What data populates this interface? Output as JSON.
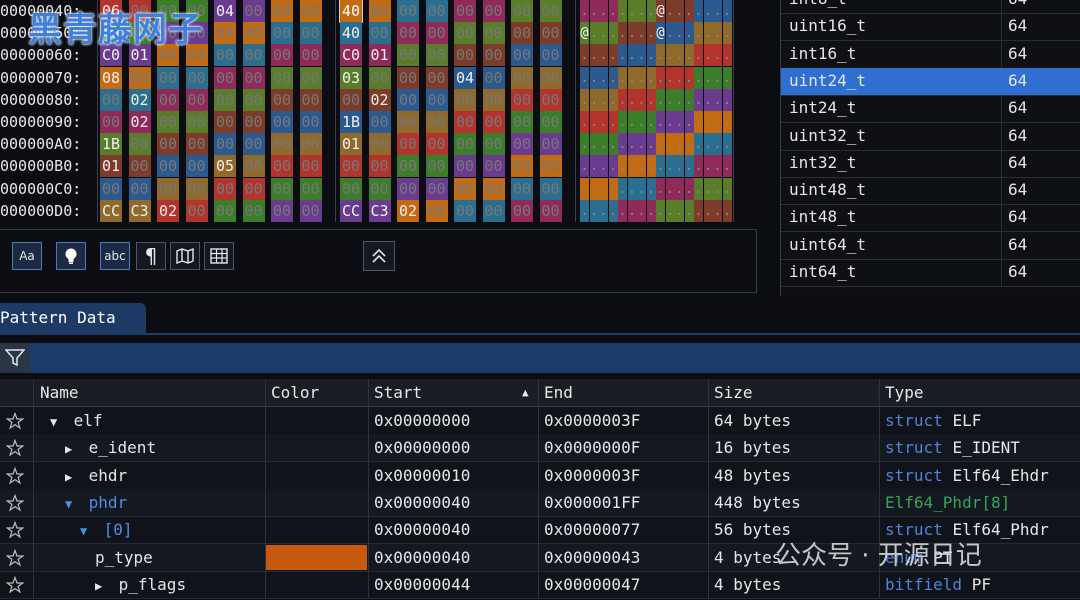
{
  "hex_view": {
    "rows": [
      {
        "addr": "00000040:",
        "bytes1": [
          "06",
          "00",
          "00",
          "00",
          "04",
          "00",
          "00",
          "00"
        ],
        "bytes2": [
          "40",
          "00",
          "00",
          "00",
          "00",
          "00",
          "00",
          "00"
        ],
        "ascii": "........@......."
      },
      {
        "addr": "00000050:",
        "bytes1": [
          "40",
          "00",
          "00",
          "00",
          "00",
          "00",
          "00",
          "00"
        ],
        "bytes2": [
          "40",
          "00",
          "00",
          "00",
          "00",
          "00",
          "00",
          "00"
        ],
        "ascii": "@.......@......."
      },
      {
        "addr": "00000060:",
        "bytes1": [
          "C0",
          "01",
          "00",
          "00",
          "00",
          "00",
          "00",
          "00"
        ],
        "bytes2": [
          "C0",
          "01",
          "00",
          "00",
          "00",
          "00",
          "00",
          "00"
        ],
        "ascii": "................"
      },
      {
        "addr": "00000070:",
        "bytes1": [
          "08",
          "00",
          "00",
          "00",
          "00",
          "00",
          "00",
          "00"
        ],
        "bytes2": [
          "03",
          "00",
          "00",
          "00",
          "04",
          "00",
          "00",
          "00"
        ],
        "ascii": "................"
      },
      {
        "addr": "00000080:",
        "bytes1": [
          "00",
          "02",
          "00",
          "00",
          "00",
          "00",
          "00",
          "00"
        ],
        "bytes2": [
          "00",
          "02",
          "00",
          "00",
          "00",
          "00",
          "00",
          "00"
        ],
        "ascii": "................"
      },
      {
        "addr": "00000090:",
        "bytes1": [
          "00",
          "02",
          "00",
          "00",
          "00",
          "00",
          "00",
          "00"
        ],
        "bytes2": [
          "1B",
          "00",
          "00",
          "00",
          "00",
          "00",
          "00",
          "00"
        ],
        "ascii": "................"
      },
      {
        "addr": "000000A0:",
        "bytes1": [
          "1B",
          "00",
          "00",
          "00",
          "00",
          "00",
          "00",
          "00"
        ],
        "bytes2": [
          "01",
          "00",
          "00",
          "00",
          "00",
          "00",
          "00",
          "00"
        ],
        "ascii": "................"
      },
      {
        "addr": "000000B0:",
        "bytes1": [
          "01",
          "00",
          "00",
          "00",
          "05",
          "00",
          "00",
          "00"
        ],
        "bytes2": [
          "00",
          "00",
          "00",
          "00",
          "00",
          "00",
          "00",
          "00"
        ],
        "ascii": "................"
      },
      {
        "addr": "000000C0:",
        "bytes1": [
          "00",
          "00",
          "00",
          "00",
          "00",
          "00",
          "00",
          "00"
        ],
        "bytes2": [
          "00",
          "00",
          "00",
          "00",
          "00",
          "00",
          "00",
          "00"
        ],
        "ascii": "................"
      },
      {
        "addr": "000000D0:",
        "bytes1": [
          "CC",
          "C3",
          "02",
          "00",
          "00",
          "00",
          "00",
          "00"
        ],
        "bytes2": [
          "CC",
          "C3",
          "02",
          "00",
          "00",
          "00",
          "00",
          "00"
        ],
        "ascii": "................"
      }
    ],
    "toolbar": {
      "case_label": "Aa",
      "abc_label": "abc",
      "pilcrow_label": "¶"
    }
  },
  "type_table": {
    "rows": [
      {
        "name": "int8_t",
        "value": "64"
      },
      {
        "name": "uint16_t",
        "value": "64"
      },
      {
        "name": "int16_t",
        "value": "64"
      },
      {
        "name": "uint24_t",
        "value": "64",
        "selected": true
      },
      {
        "name": "int24_t",
        "value": "64"
      },
      {
        "name": "uint32_t",
        "value": "64"
      },
      {
        "name": "int32_t",
        "value": "64"
      },
      {
        "name": "uint48_t",
        "value": "64"
      },
      {
        "name": "int48_t",
        "value": "64"
      },
      {
        "name": "uint64_t",
        "value": "64"
      },
      {
        "name": "int64_t",
        "value": "64"
      }
    ]
  },
  "pattern_data": {
    "tab_label": "Pattern Data",
    "columns": {
      "name": "Name",
      "color": "Color",
      "start": "Start",
      "end": "End",
      "size": "Size",
      "type": "Type"
    },
    "rows": [
      {
        "indent": 0,
        "expander": "▼",
        "name": "elf",
        "start": "0x00000000",
        "end": "0x0000003F",
        "size": "64 bytes",
        "type_kw": "struct",
        "type_name": "ELF"
      },
      {
        "indent": 1,
        "expander": "▶",
        "name": "e_ident",
        "start": "0x00000000",
        "end": "0x0000000F",
        "size": "16 bytes",
        "type_kw": "struct",
        "type_name": "E_IDENT"
      },
      {
        "indent": 1,
        "expander": "▶",
        "name": "ehdr",
        "start": "0x00000010",
        "end": "0x0000003F",
        "size": "48 bytes",
        "type_kw": "struct",
        "type_name": "Elf64_Ehdr"
      },
      {
        "indent": 1,
        "expander": "▼",
        "name": "phdr",
        "start": "0x00000040",
        "end": "0x000001FF",
        "size": "448 bytes",
        "type_kw": "",
        "type_name": "Elf64_Phdr[8]",
        "highlight": true
      },
      {
        "indent": 2,
        "expander": "▼",
        "name": "[0]",
        "start": "0x00000040",
        "end": "0x00000077",
        "size": "56 bytes",
        "type_kw": "struct",
        "type_name": "Elf64_Phdr",
        "highlight": true
      },
      {
        "indent": 3,
        "expander": "",
        "name": "p_type",
        "start": "0x00000040",
        "end": "0x00000043",
        "size": "4 bytes",
        "type_kw": "enum",
        "type_name": "PT",
        "color": "#c85a10"
      },
      {
        "indent": 3,
        "expander": "▶",
        "name": "p_flags",
        "start": "0x00000044",
        "end": "0x00000047",
        "size": "4 bytes",
        "type_kw": "bitfield",
        "type_name": "PF"
      }
    ]
  },
  "watermarks": {
    "top_left": "黑青藤网子",
    "bottom_right": "公众号 · 开源日记"
  },
  "colors": {
    "accent": "#2f6fd1",
    "tab": "#1c3a64",
    "filter_bar": "#1a3c6b",
    "keyword": "#4f83d6",
    "array_type": "#3aa35a",
    "p_type_color": "#c85a10"
  }
}
